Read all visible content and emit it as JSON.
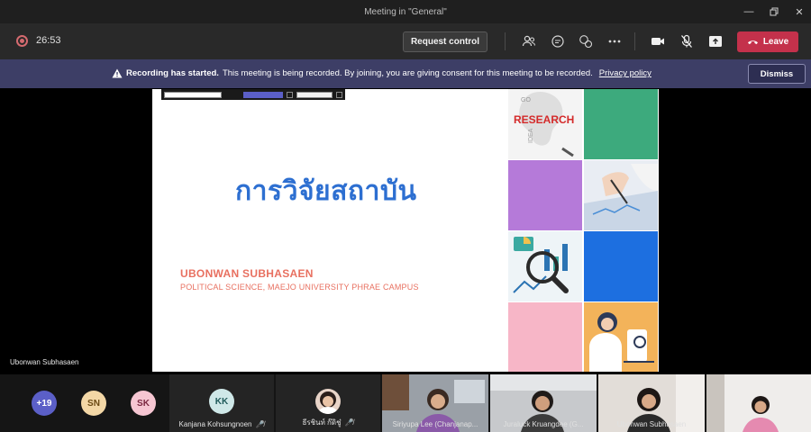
{
  "window": {
    "title": "Meeting in \"General\""
  },
  "toolbar": {
    "timer": "26:53",
    "request_control_label": "Request control",
    "leave_label": "Leave"
  },
  "banner": {
    "title": "Recording has started.",
    "message": "This meeting is being recorded. By joining, you are giving consent for this meeting to be recorded.",
    "link": "Privacy policy",
    "dismiss_label": "Dismiss"
  },
  "stage": {
    "presenter_name": "Ubonwan Subhasaen",
    "slide": {
      "title": "การวิจัยสถาบัน",
      "author": "UBONWAN SUBHASAEN",
      "affiliation": "POLITICAL SCIENCE, MAEJO UNIVERSITY PHRAE CAMPUS",
      "research_word": "RESEARCH"
    }
  },
  "participants": {
    "overflow_count": "+19",
    "avatars": [
      {
        "initials": "SN",
        "color": "#f3d7a6"
      },
      {
        "initials": "SK",
        "color": "#f6c6d2"
      }
    ],
    "tiles": [
      {
        "initials": "KK",
        "name": "Kanjana Kohsungnoen"
      },
      {
        "name": "ธีรชินท์ ก๊ดิชู๋"
      }
    ],
    "video": [
      {
        "name": "Siriyupa Lee (Chanjanap..."
      },
      {
        "name": "Juraluck Kruangdee (G..."
      },
      {
        "name": "Ubonwan Subhasaen"
      },
      {
        "name": ""
      }
    ]
  }
}
